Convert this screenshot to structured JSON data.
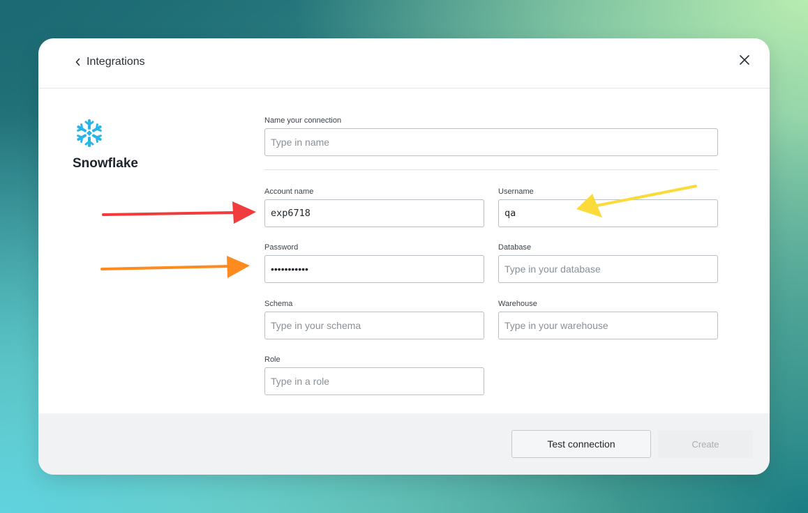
{
  "header": {
    "back_label": "Integrations"
  },
  "brand": {
    "name": "Snowflake",
    "logo_icon": "snowflake-icon",
    "logo_color": "#29b5e8"
  },
  "form": {
    "connection_name": {
      "label": "Name your connection",
      "value": "",
      "placeholder": "Type in name"
    },
    "account_name": {
      "label": "Account name",
      "value": "exp6718",
      "placeholder": ""
    },
    "username": {
      "label": "Username",
      "value": "qa",
      "placeholder": ""
    },
    "password": {
      "label": "Password",
      "value": "•••••••••••",
      "placeholder": ""
    },
    "database": {
      "label": "Database",
      "value": "",
      "placeholder": "Type in your database"
    },
    "schema": {
      "label": "Schema",
      "value": "",
      "placeholder": "Type in your schema"
    },
    "warehouse": {
      "label": "Warehouse",
      "value": "",
      "placeholder": "Type in your warehouse"
    },
    "role": {
      "label": "Role",
      "value": "",
      "placeholder": "Type in a role"
    }
  },
  "footer": {
    "test_label": "Test connection",
    "create_label": "Create"
  },
  "annotations": {
    "arrow_colors": [
      "#f03c3c",
      "#ff8a1f",
      "#fbdb3a"
    ]
  }
}
